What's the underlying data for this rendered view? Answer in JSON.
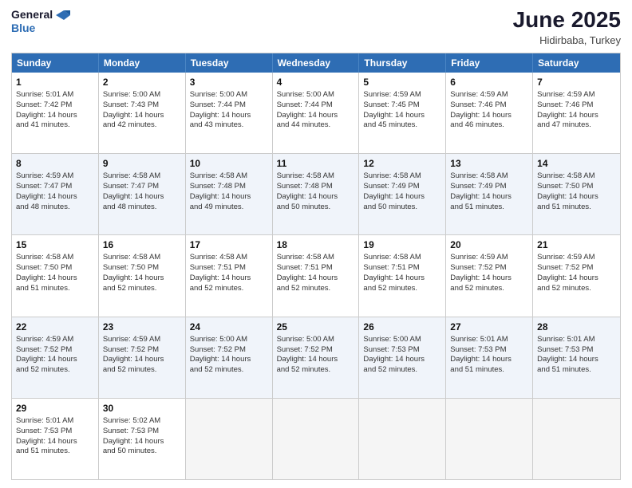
{
  "logo": {
    "line1": "General",
    "line2": "Blue"
  },
  "title": "June 2025",
  "location": "Hidirbaba, Turkey",
  "header_days": [
    "Sunday",
    "Monday",
    "Tuesday",
    "Wednesday",
    "Thursday",
    "Friday",
    "Saturday"
  ],
  "rows": [
    {
      "alt": false,
      "cells": [
        {
          "day": "1",
          "lines": [
            "Sunrise: 5:01 AM",
            "Sunset: 7:42 PM",
            "Daylight: 14 hours",
            "and 41 minutes."
          ]
        },
        {
          "day": "2",
          "lines": [
            "Sunrise: 5:00 AM",
            "Sunset: 7:43 PM",
            "Daylight: 14 hours",
            "and 42 minutes."
          ]
        },
        {
          "day": "3",
          "lines": [
            "Sunrise: 5:00 AM",
            "Sunset: 7:44 PM",
            "Daylight: 14 hours",
            "and 43 minutes."
          ]
        },
        {
          "day": "4",
          "lines": [
            "Sunrise: 5:00 AM",
            "Sunset: 7:44 PM",
            "Daylight: 14 hours",
            "and 44 minutes."
          ]
        },
        {
          "day": "5",
          "lines": [
            "Sunrise: 4:59 AM",
            "Sunset: 7:45 PM",
            "Daylight: 14 hours",
            "and 45 minutes."
          ]
        },
        {
          "day": "6",
          "lines": [
            "Sunrise: 4:59 AM",
            "Sunset: 7:46 PM",
            "Daylight: 14 hours",
            "and 46 minutes."
          ]
        },
        {
          "day": "7",
          "lines": [
            "Sunrise: 4:59 AM",
            "Sunset: 7:46 PM",
            "Daylight: 14 hours",
            "and 47 minutes."
          ]
        }
      ]
    },
    {
      "alt": true,
      "cells": [
        {
          "day": "8",
          "lines": [
            "Sunrise: 4:59 AM",
            "Sunset: 7:47 PM",
            "Daylight: 14 hours",
            "and 48 minutes."
          ]
        },
        {
          "day": "9",
          "lines": [
            "Sunrise: 4:58 AM",
            "Sunset: 7:47 PM",
            "Daylight: 14 hours",
            "and 48 minutes."
          ]
        },
        {
          "day": "10",
          "lines": [
            "Sunrise: 4:58 AM",
            "Sunset: 7:48 PM",
            "Daylight: 14 hours",
            "and 49 minutes."
          ]
        },
        {
          "day": "11",
          "lines": [
            "Sunrise: 4:58 AM",
            "Sunset: 7:48 PM",
            "Daylight: 14 hours",
            "and 50 minutes."
          ]
        },
        {
          "day": "12",
          "lines": [
            "Sunrise: 4:58 AM",
            "Sunset: 7:49 PM",
            "Daylight: 14 hours",
            "and 50 minutes."
          ]
        },
        {
          "day": "13",
          "lines": [
            "Sunrise: 4:58 AM",
            "Sunset: 7:49 PM",
            "Daylight: 14 hours",
            "and 51 minutes."
          ]
        },
        {
          "day": "14",
          "lines": [
            "Sunrise: 4:58 AM",
            "Sunset: 7:50 PM",
            "Daylight: 14 hours",
            "and 51 minutes."
          ]
        }
      ]
    },
    {
      "alt": false,
      "cells": [
        {
          "day": "15",
          "lines": [
            "Sunrise: 4:58 AM",
            "Sunset: 7:50 PM",
            "Daylight: 14 hours",
            "and 51 minutes."
          ]
        },
        {
          "day": "16",
          "lines": [
            "Sunrise: 4:58 AM",
            "Sunset: 7:50 PM",
            "Daylight: 14 hours",
            "and 52 minutes."
          ]
        },
        {
          "day": "17",
          "lines": [
            "Sunrise: 4:58 AM",
            "Sunset: 7:51 PM",
            "Daylight: 14 hours",
            "and 52 minutes."
          ]
        },
        {
          "day": "18",
          "lines": [
            "Sunrise: 4:58 AM",
            "Sunset: 7:51 PM",
            "Daylight: 14 hours",
            "and 52 minutes."
          ]
        },
        {
          "day": "19",
          "lines": [
            "Sunrise: 4:58 AM",
            "Sunset: 7:51 PM",
            "Daylight: 14 hours",
            "and 52 minutes."
          ]
        },
        {
          "day": "20",
          "lines": [
            "Sunrise: 4:59 AM",
            "Sunset: 7:52 PM",
            "Daylight: 14 hours",
            "and 52 minutes."
          ]
        },
        {
          "day": "21",
          "lines": [
            "Sunrise: 4:59 AM",
            "Sunset: 7:52 PM",
            "Daylight: 14 hours",
            "and 52 minutes."
          ]
        }
      ]
    },
    {
      "alt": true,
      "cells": [
        {
          "day": "22",
          "lines": [
            "Sunrise: 4:59 AM",
            "Sunset: 7:52 PM",
            "Daylight: 14 hours",
            "and 52 minutes."
          ]
        },
        {
          "day": "23",
          "lines": [
            "Sunrise: 4:59 AM",
            "Sunset: 7:52 PM",
            "Daylight: 14 hours",
            "and 52 minutes."
          ]
        },
        {
          "day": "24",
          "lines": [
            "Sunrise: 5:00 AM",
            "Sunset: 7:52 PM",
            "Daylight: 14 hours",
            "and 52 minutes."
          ]
        },
        {
          "day": "25",
          "lines": [
            "Sunrise: 5:00 AM",
            "Sunset: 7:52 PM",
            "Daylight: 14 hours",
            "and 52 minutes."
          ]
        },
        {
          "day": "26",
          "lines": [
            "Sunrise: 5:00 AM",
            "Sunset: 7:53 PM",
            "Daylight: 14 hours",
            "and 52 minutes."
          ]
        },
        {
          "day": "27",
          "lines": [
            "Sunrise: 5:01 AM",
            "Sunset: 7:53 PM",
            "Daylight: 14 hours",
            "and 51 minutes."
          ]
        },
        {
          "day": "28",
          "lines": [
            "Sunrise: 5:01 AM",
            "Sunset: 7:53 PM",
            "Daylight: 14 hours",
            "and 51 minutes."
          ]
        }
      ]
    },
    {
      "alt": false,
      "cells": [
        {
          "day": "29",
          "lines": [
            "Sunrise: 5:01 AM",
            "Sunset: 7:53 PM",
            "Daylight: 14 hours",
            "and 51 minutes."
          ]
        },
        {
          "day": "30",
          "lines": [
            "Sunrise: 5:02 AM",
            "Sunset: 7:53 PM",
            "Daylight: 14 hours",
            "and 50 minutes."
          ]
        },
        {
          "day": "",
          "lines": [],
          "empty": true
        },
        {
          "day": "",
          "lines": [],
          "empty": true
        },
        {
          "day": "",
          "lines": [],
          "empty": true
        },
        {
          "day": "",
          "lines": [],
          "empty": true
        },
        {
          "day": "",
          "lines": [],
          "empty": true
        }
      ]
    }
  ]
}
